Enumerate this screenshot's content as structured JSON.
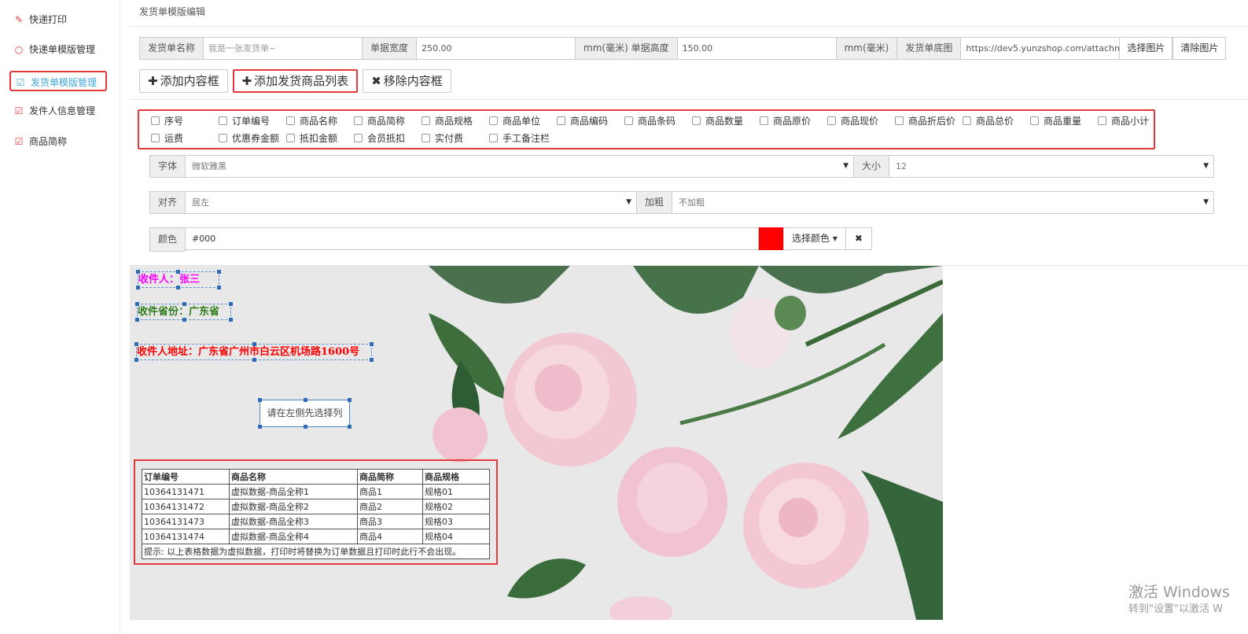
{
  "sidebar": {
    "items": [
      {
        "label": "快递打印",
        "icon": "wand-icon"
      },
      {
        "label": "快递单模版管理",
        "icon": "circle-icon"
      },
      {
        "label": "发货单模版管理",
        "icon": "edit-icon"
      },
      {
        "label": "发件人信息管理",
        "icon": "edit-icon"
      },
      {
        "label": "商品简称",
        "icon": "edit-icon"
      }
    ]
  },
  "page": {
    "title": "发货单模版编辑"
  },
  "form": {
    "name_label": "发货单名称",
    "name_placeholder": "我是一张发货单~",
    "width_label": "单据宽度",
    "width_value": "250.00",
    "width_unit_height_label": "mm(毫米) 单据高度",
    "height_value": "150.00",
    "height_unit": "mm(毫米)",
    "bg_label": "发货单底图",
    "bg_value": "https://dev5.yunzshop.com/attachment/im",
    "choose_image": "选择图片",
    "clear_image": "清除图片"
  },
  "toolbar": {
    "add_box": "添加内容框",
    "add_goods_list": "添加发货商品列表",
    "remove_box": "移除内容框"
  },
  "columns": {
    "row1": [
      "序号",
      "订单编号",
      "商品名称",
      "商品简称",
      "商品规格",
      "商品单位",
      "商品编码",
      "商品条码",
      "商品数量",
      "商品原价",
      "商品现价",
      "商品折后价",
      "商品总价",
      "商品重量",
      "商品小计"
    ],
    "row2": [
      "运费",
      "优惠券金额",
      "抵扣金额",
      "会员抵扣",
      "实付费",
      "手工备注栏"
    ]
  },
  "style": {
    "font_label": "字体",
    "font_value": "微软雅黑",
    "size_label": "大小",
    "size_value": "12",
    "align_label": "对齐",
    "align_value": "居左",
    "bold_label": "加粗",
    "bold_value": "不加粗",
    "color_label": "颜色",
    "color_value": "#000",
    "color_swatch": "#ff0000",
    "choose_color": "选择颜色"
  },
  "canvas": {
    "receiver": "收件人：张三",
    "receiver_color": "#ff00ff",
    "province": "收件省份：广东省",
    "province_color": "#2e7d1a",
    "address": "收件人地址：广东省广州市白云区机场路1600号",
    "address_color": "#ff0000",
    "hint": "请在左侧先选择列",
    "table": {
      "headers": [
        "订单编号",
        "商品名称",
        "商品简称",
        "商品规格"
      ],
      "rows": [
        [
          "10364131471",
          "虚拟数据-商品全称1",
          "商品1",
          "规格01"
        ],
        [
          "10364131472",
          "虚拟数据-商品全称2",
          "商品2",
          "规格02"
        ],
        [
          "10364131473",
          "虚拟数据-商品全称3",
          "商品3",
          "规格03"
        ],
        [
          "10364131474",
          "虚拟数据-商品全称4",
          "商品4",
          "规格04"
        ]
      ],
      "note": "提示: 以上表格数据为虚拟数据，打印时将替换为订单数据且打印时此行不会出现。"
    }
  },
  "watermark": {
    "line1": "激活 Windows",
    "line2": "转到\"设置\"以激活 W"
  }
}
